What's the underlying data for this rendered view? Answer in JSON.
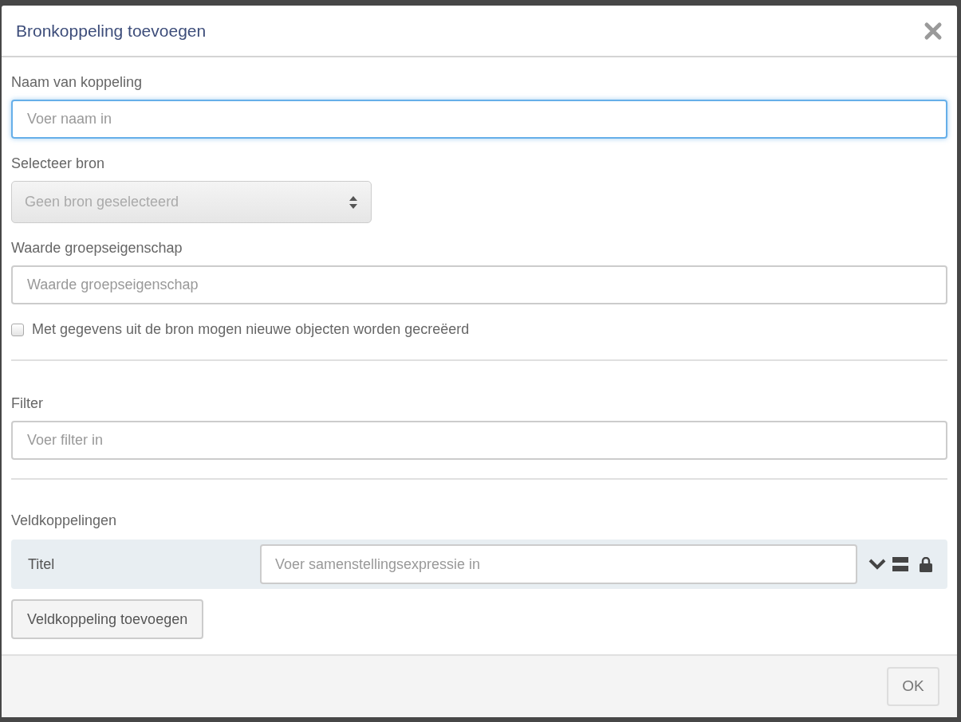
{
  "dialog": {
    "title": "Bronkoppeling toevoegen"
  },
  "name_field": {
    "label": "Naam van koppeling",
    "placeholder": "Voer naam in",
    "focused": true
  },
  "source_select": {
    "label": "Selecteer bron",
    "value": "Geen bron geselecteerd",
    "disabled": true
  },
  "group_value_field": {
    "label": "Waarde groepseigenschap",
    "placeholder": "Waarde groepseigenschap"
  },
  "create_objects": {
    "label": "Met gegevens uit de bron mogen nieuwe objecten worden gecreëerd",
    "checked": false
  },
  "filter_field": {
    "label": "Filter",
    "placeholder": "Voer filter in"
  },
  "field_mappings": {
    "label": "Veldkoppelingen",
    "rows": [
      {
        "name": "Titel",
        "placeholder": "Voer samenstellingsexpressie in"
      }
    ],
    "add_button": "Veldkoppeling toevoegen"
  },
  "ok_button": {
    "label": "OK",
    "disabled": true
  }
}
